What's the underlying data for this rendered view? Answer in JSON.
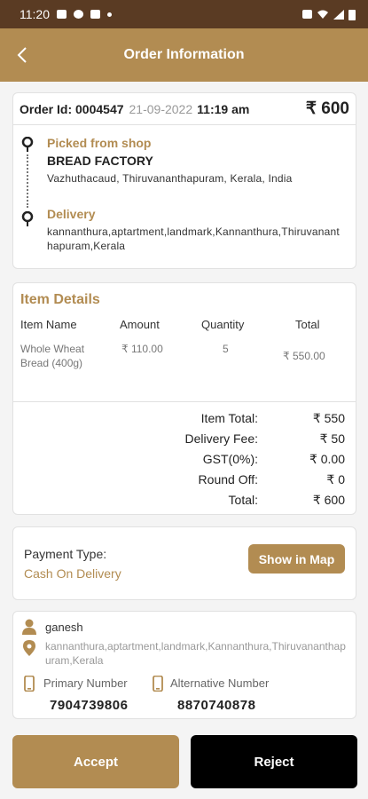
{
  "status_bar": {
    "time": "11:20"
  },
  "header": {
    "title": "Order Information"
  },
  "order": {
    "id_label": "Order Id: 0004547",
    "date": "21-09-2022",
    "time": "11:19 am",
    "amount": "₹ 600",
    "pickup_title": "Picked from shop",
    "shop_name": "BREAD FACTORY",
    "shop_address": "Vazhuthacaud, Thiruvananthapuram, Kerala, India",
    "delivery_title": "Delivery",
    "delivery_address": "kannanthura,aptartment,landmark,Kannanthura,Thiruvananthapuram,Kerala"
  },
  "items": {
    "title": "Item Details",
    "columns": [
      "Item Name",
      "Amount",
      "Quantity",
      "Total"
    ],
    "rows": [
      {
        "name": "Whole Wheat Bread (400g)",
        "amount": "₹ 110.00",
        "quantity": "5",
        "total": "₹ 550.00"
      }
    ]
  },
  "summary": {
    "item_total_label": "Item Total:",
    "item_total": "₹ 550",
    "delivery_fee_label": "Delivery Fee:",
    "delivery_fee": "₹ 50",
    "gst_label": "GST(0%):",
    "gst": "₹ 0.00",
    "round_off_label": "Round Off:",
    "round_off": "₹ 0",
    "total_label": "Total:",
    "total": "₹ 600"
  },
  "payment": {
    "label": "Payment Type:",
    "value": "Cash On Delivery",
    "map_button": "Show in Map"
  },
  "customer": {
    "name": "ganesh",
    "address": "kannanthura,aptartment,landmark,Kannanthura,Thiruvananthapuram,Kerala",
    "primary_label": "Primary Number",
    "primary_number": "7904739806",
    "alternative_label": "Alternative Number",
    "alternative_number": "8870740878"
  },
  "actions": {
    "accept": "Accept",
    "reject": "Reject"
  },
  "colors": {
    "accent": "#b28c52",
    "status_bar": "#5a3b23",
    "reject": "#000000"
  }
}
